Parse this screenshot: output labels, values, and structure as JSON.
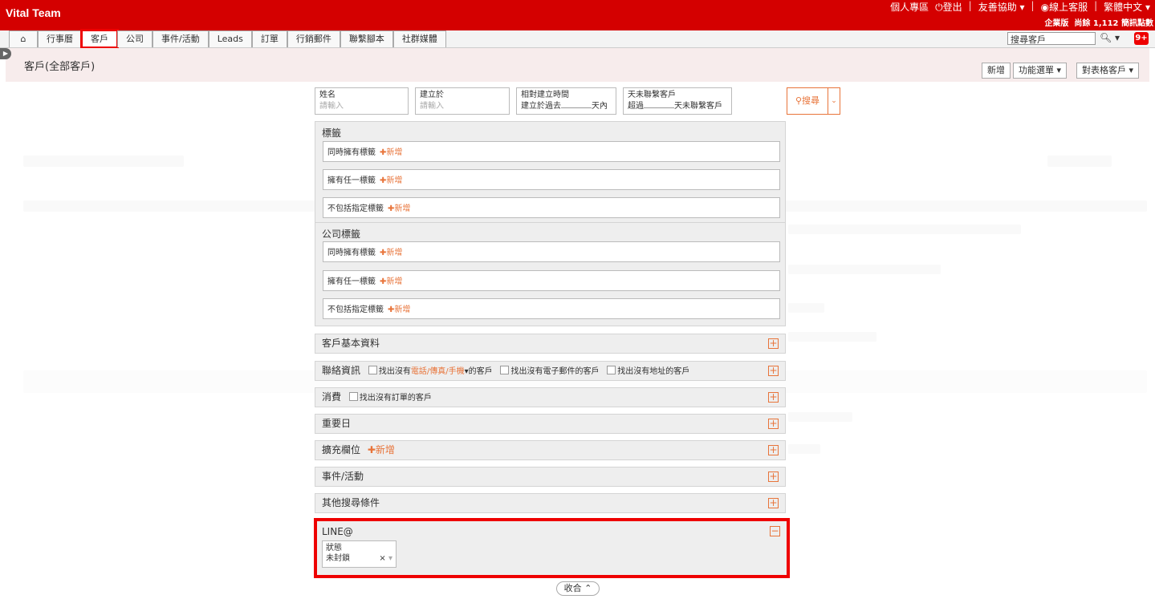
{
  "app": {
    "title": "Vital Team"
  },
  "header": {
    "links": [
      "個人專區",
      "登出",
      "友善協助",
      "線上客服",
      "繁體中文"
    ],
    "edition": "企業版",
    "sms_balance": "尚餘 1,112 簡訊點數"
  },
  "nav": {
    "tabs": [
      "行事曆",
      "客戶",
      "公司",
      "事件/活動",
      "Leads",
      "訂單",
      "行銷郵件",
      "聯繫腳本",
      "社群媒體"
    ],
    "active_tab": "客戶",
    "search_placeholder": "搜尋客戶",
    "notification_count": "9+"
  },
  "page": {
    "title": "客戶(全部客戶)",
    "buttons": {
      "add": "新增",
      "function_menu": "功能選單",
      "table_customers": "對表格客戶"
    }
  },
  "filters": {
    "name": {
      "label": "姓名",
      "placeholder": "請輸入"
    },
    "created_at": {
      "label": "建立於",
      "placeholder": "請輸入"
    },
    "relative_created": {
      "label": "相對建立時間",
      "prefix": "建立於過去",
      "suffix": "天內"
    },
    "no_contact": {
      "label": "天未聯繫客戶",
      "prefix": "超過",
      "suffix": "天未聯繫客戶"
    },
    "search_button": "搜尋"
  },
  "tags": {
    "title": "標籤",
    "rows": [
      "同時擁有標籤",
      "擁有任一標籤",
      "不包括指定標籤"
    ],
    "add_label": "新增"
  },
  "company_tags": {
    "title": "公司標籤",
    "rows": [
      "同時擁有標籤",
      "擁有任一標籤",
      "不包括指定標籤"
    ],
    "add_label": "新增"
  },
  "sections": {
    "basic": "客戶基本資料",
    "contact": {
      "title": "聯絡資訊",
      "opt1_prefix": "找出沒有",
      "opt1_highlight": "電話/傳真/手機",
      "opt1_suffix": "的客戶",
      "opt2": "找出沒有電子郵件的客戶",
      "opt3": "找出沒有地址的客戶"
    },
    "consumption": {
      "title": "消費",
      "opt": "找出沒有訂單的客戶"
    },
    "important_date": "重要日",
    "extended_fields": {
      "title": "擴充欄位",
      "add_label": "新增"
    },
    "events": "事件/活動",
    "other": "其他搜尋條件"
  },
  "line": {
    "title": "LINE@",
    "status_label": "狀態",
    "status_value": "未封鎖"
  },
  "collapse_label": "收合"
}
